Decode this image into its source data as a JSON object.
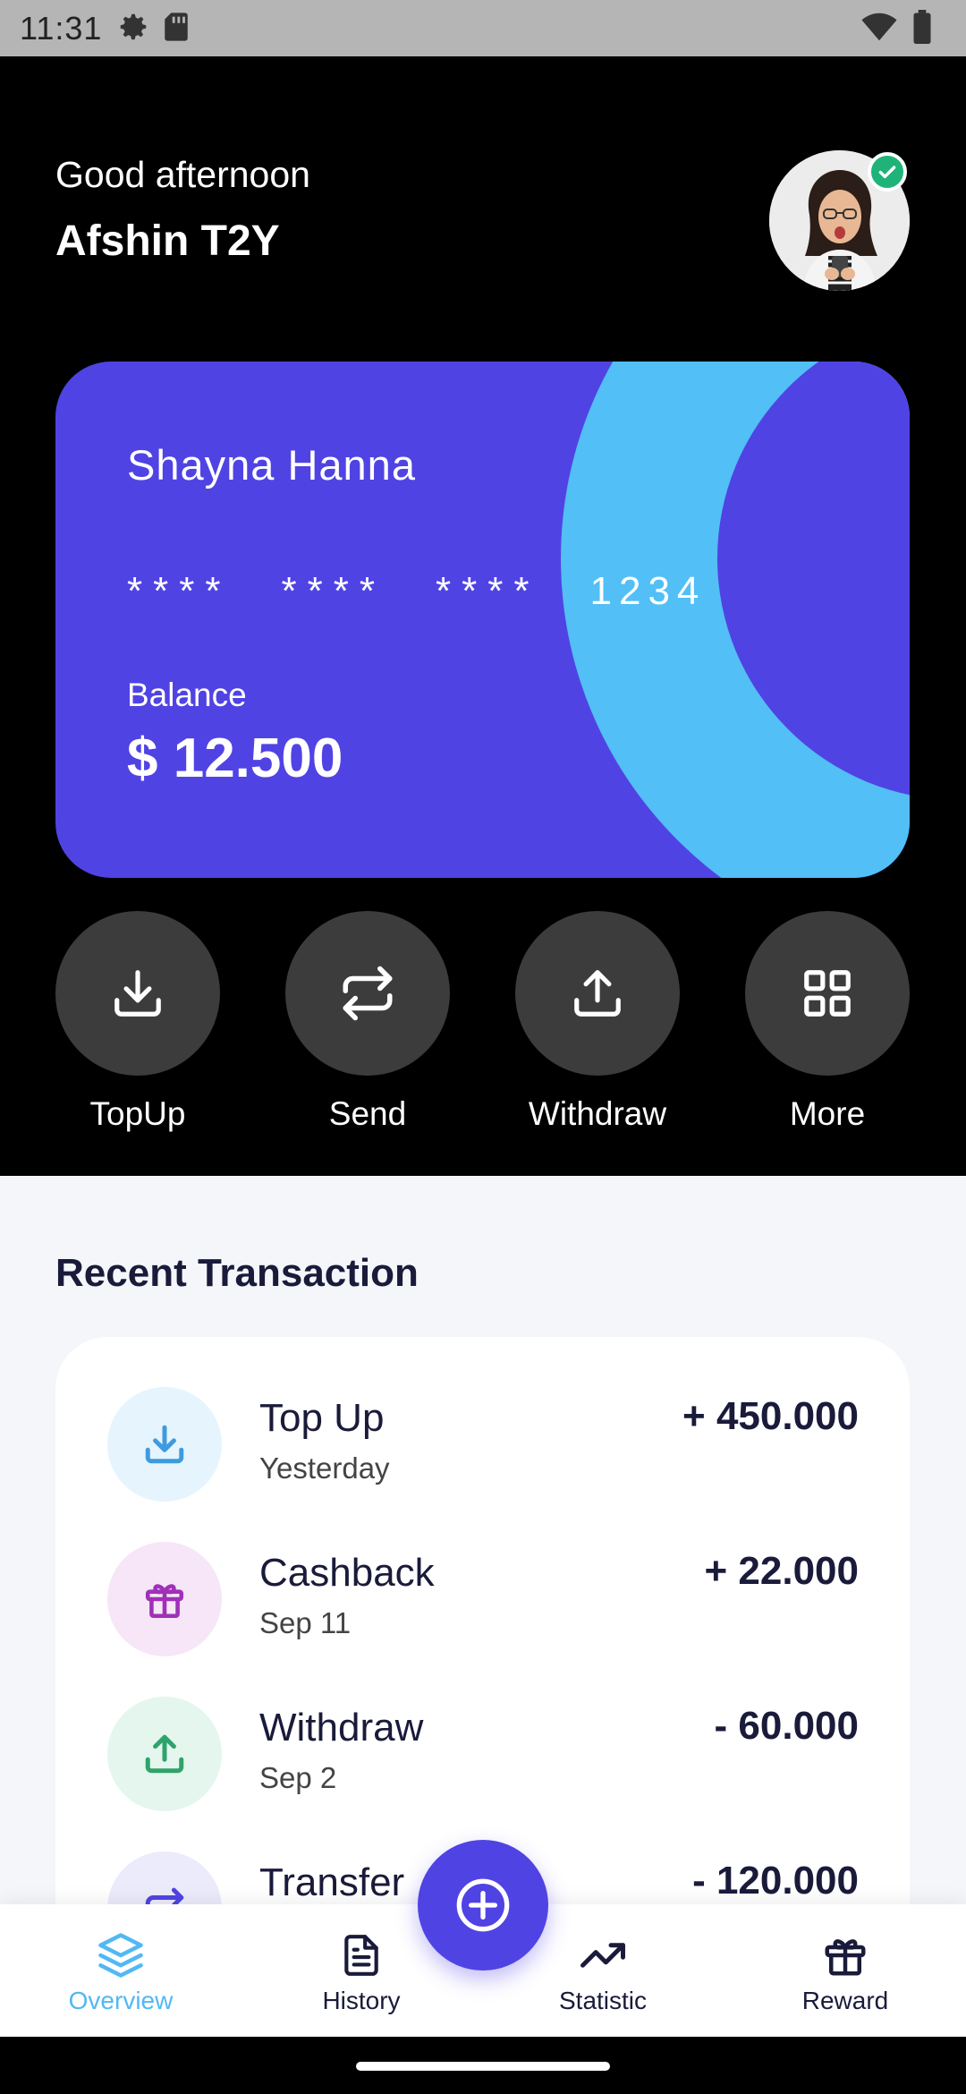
{
  "status_bar": {
    "time": "11:31",
    "left_icons": [
      "settings-icon",
      "sd-card-icon"
    ],
    "right_icons": [
      "wifi-icon",
      "battery-icon"
    ]
  },
  "header": {
    "greeting": "Good afternoon",
    "user_name": "Afshin T2Y",
    "avatar_verified": true
  },
  "card": {
    "holder_name": "Shayna Hanna",
    "number_groups": [
      "****",
      "****",
      "****",
      "1234"
    ],
    "balance_label": "Balance",
    "balance_value": "$ 12.500",
    "colors": {
      "background": "#5043e4",
      "accent": "#52bff6"
    }
  },
  "actions": [
    {
      "label": "TopUp",
      "icon": "download-icon"
    },
    {
      "label": "Send",
      "icon": "transfer-arrows-icon"
    },
    {
      "label": "Withdraw",
      "icon": "upload-icon"
    },
    {
      "label": "More",
      "icon": "grid-icon"
    }
  ],
  "transactions": {
    "title": "Recent Transaction",
    "items": [
      {
        "title": "Top Up",
        "date": "Yesterday",
        "amount": "+ 450.000",
        "icon": "download-icon",
        "icon_color": "#3d9be0",
        "icon_bg": "#e6f4fd"
      },
      {
        "title": "Cashback",
        "date": "Sep 11",
        "amount": "+ 22.000",
        "icon": "gift-icon",
        "icon_color": "#a030b8",
        "icon_bg": "#f6e6f7"
      },
      {
        "title": "Withdraw",
        "date": "Sep 2",
        "amount": "- 60.000",
        "icon": "upload-icon",
        "icon_color": "#2ea36b",
        "icon_bg": "#e4f6ed"
      },
      {
        "title": "Transfer",
        "date": "",
        "amount": "- 120.000",
        "icon": "transfer-arrows-icon",
        "icon_color": "#5043e4",
        "icon_bg": "#ecebfb"
      }
    ]
  },
  "bottom_nav": {
    "items": [
      {
        "label": "Overview",
        "icon": "layers-icon",
        "active": true
      },
      {
        "label": "History",
        "icon": "document-icon",
        "active": false
      },
      {
        "label": "Statistic",
        "icon": "trending-up-icon",
        "active": false
      },
      {
        "label": "Reward",
        "icon": "gift-icon",
        "active": false
      }
    ],
    "fab_icon": "plus-circle-icon",
    "active_color": "#52b8f4"
  }
}
